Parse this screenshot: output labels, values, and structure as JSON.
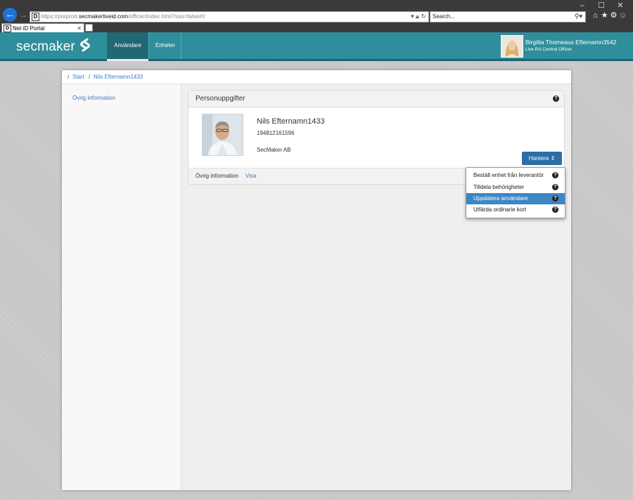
{
  "browser": {
    "url_scheme": "https://",
    "url_prefix": "preprod.",
    "url_host": "secmakerliveid.com",
    "url_path": "/officer/index.html?sso=false#!/",
    "search_placeholder": "Search...",
    "tab_title": "Net iD Portal",
    "favicon_text": "D",
    "window_controls": [
      "–",
      "☐",
      "✕"
    ]
  },
  "header": {
    "logo_text": "secmaker",
    "nav": [
      {
        "label": "Användare",
        "active": true
      },
      {
        "label": "Enheter",
        "active": false
      }
    ],
    "user_name": "Birgitta Thomeaus Efternamn3542",
    "user_role": "Live RA Central Officer"
  },
  "breadcrumb": {
    "sep": "/",
    "items": [
      "Start",
      "Nils Efternamn1433"
    ]
  },
  "sidebar": {
    "items": [
      "Övrig information"
    ]
  },
  "card": {
    "title": "Personuppgifter",
    "help": "?",
    "person_name": "Nils Efternamn1433",
    "person_id": "194812161596",
    "organization": "SecMaker AB",
    "manage_button": "Hantera",
    "manage_caret": "⇕",
    "footer_label": "Övrig information",
    "footer_link": "Visa"
  },
  "dropdown": {
    "items": [
      {
        "label": "Beställ enhet från leverantör",
        "active": false
      },
      {
        "label": "Tilldela behörigheter",
        "active": false
      },
      {
        "label": "Uppdatera användare",
        "active": true
      },
      {
        "label": "Utfärda ordinarie kort",
        "active": false
      }
    ]
  },
  "colors": {
    "header_teal": "#2f8e9c",
    "nav_active": "#1f6874",
    "button_blue": "#2c6ea7",
    "dropdown_active": "#3d86c6",
    "link_blue": "#3c7cc0"
  }
}
